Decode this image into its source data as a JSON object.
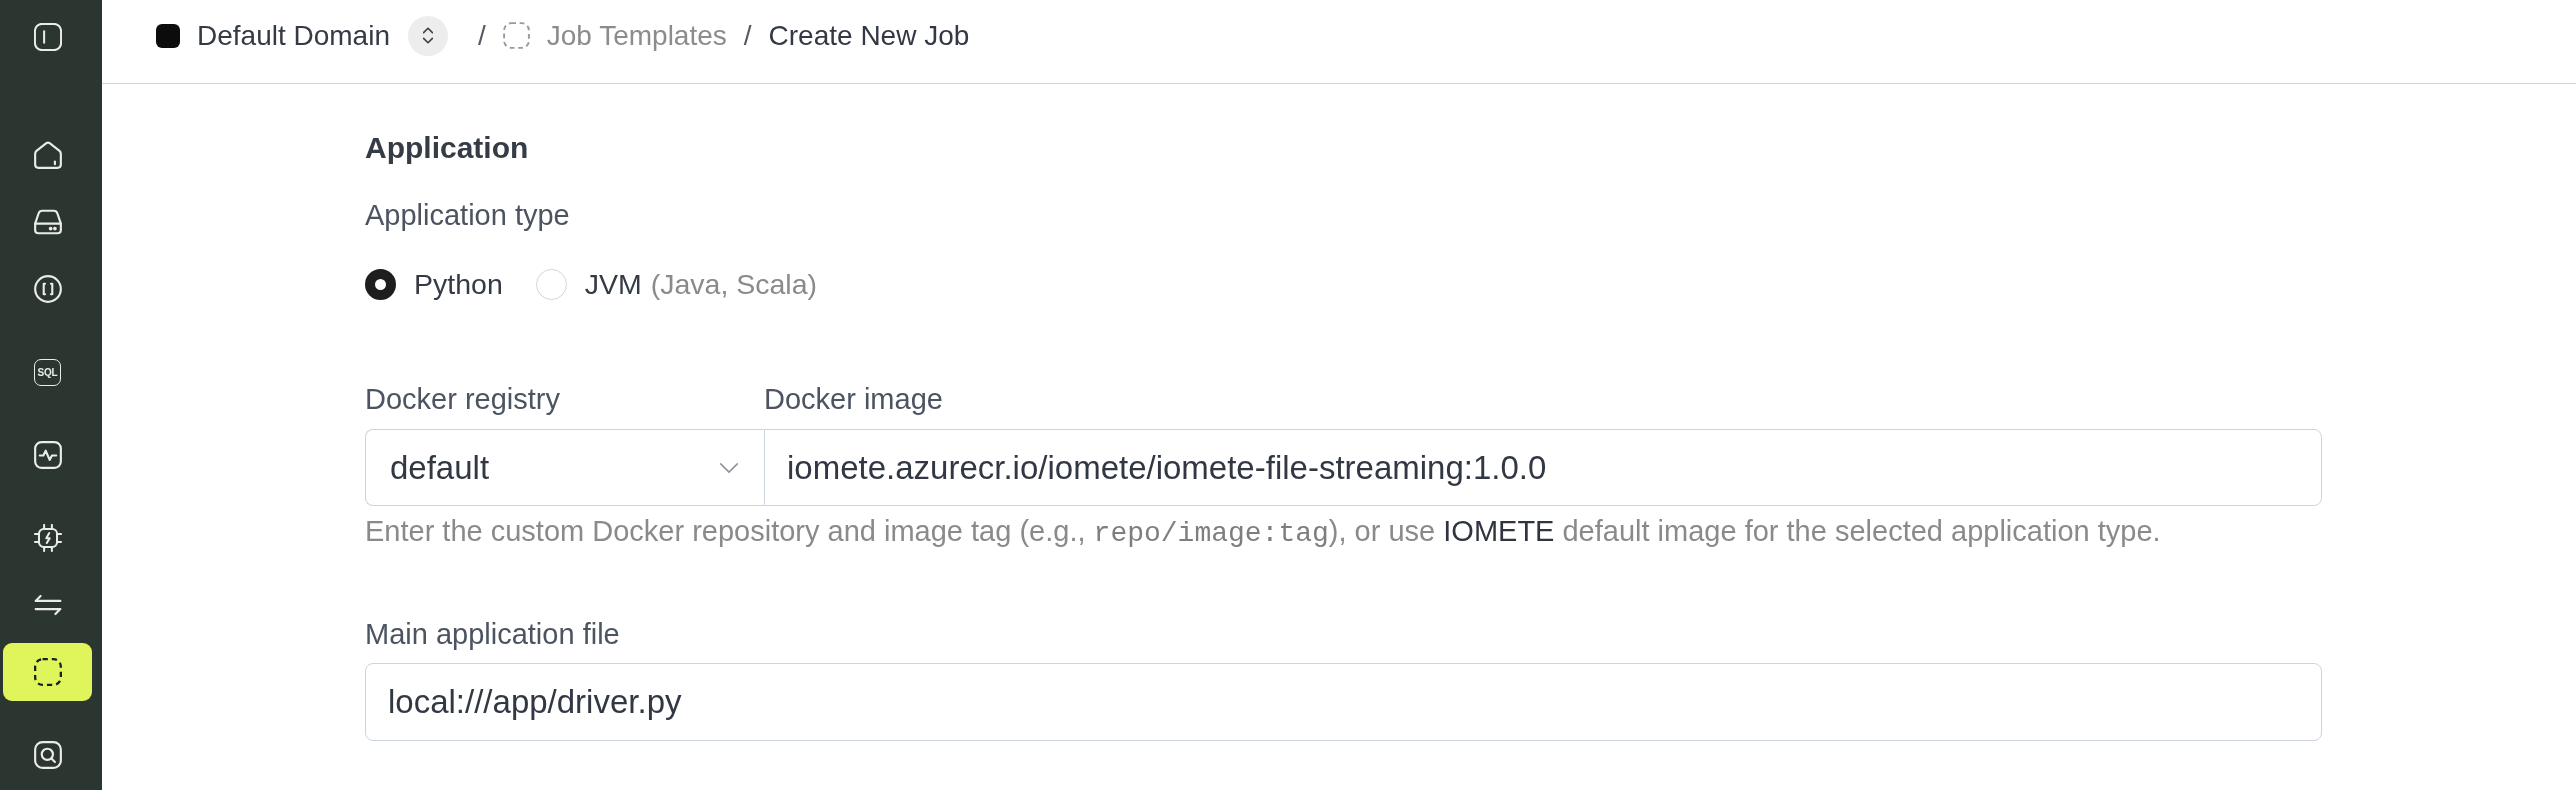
{
  "sidebar": {
    "items": [
      {
        "selected": false
      },
      {
        "selected": false
      },
      {
        "selected": false
      },
      {
        "selected": false,
        "icon_text": "SQL"
      },
      {
        "selected": false
      },
      {
        "selected": false
      },
      {
        "selected": false
      },
      {
        "selected": true
      },
      {
        "selected": false
      }
    ]
  },
  "topbar": {
    "domain": {
      "name": "Default Domain"
    },
    "breadcrumbs": [
      {
        "separator": "/",
        "label": "Job Templates",
        "kind": "link"
      },
      {
        "separator": "/",
        "label": "Create New Job",
        "kind": "current"
      }
    ]
  },
  "application": {
    "title": "Application",
    "application_type": {
      "label": "Application type",
      "options": [
        {
          "label": "Python",
          "selected": true
        },
        {
          "label": "JVM",
          "note": "(Java, Scala)",
          "selected": false
        }
      ]
    },
    "docker_registry": {
      "label": "Docker registry",
      "value": "default"
    },
    "docker_image": {
      "label": "Docker image",
      "value": "iomete.azurecr.io/iomete/iomete-file-streaming:1.0.0"
    },
    "docker_help": [
      {
        "kind": "plain",
        "text": "Enter the custom Docker repository and image tag (e.g., "
      },
      {
        "kind": "code",
        "text": "repo/image:tag"
      },
      {
        "kind": "plain",
        "text": "), or use "
      },
      {
        "kind": "strong",
        "text": "IOMETE"
      },
      {
        "kind": "plain",
        "text": " default image for the selected application type."
      }
    ],
    "main_application_file": {
      "label": "Main application file",
      "value": "local:///app/driver.py"
    }
  }
}
